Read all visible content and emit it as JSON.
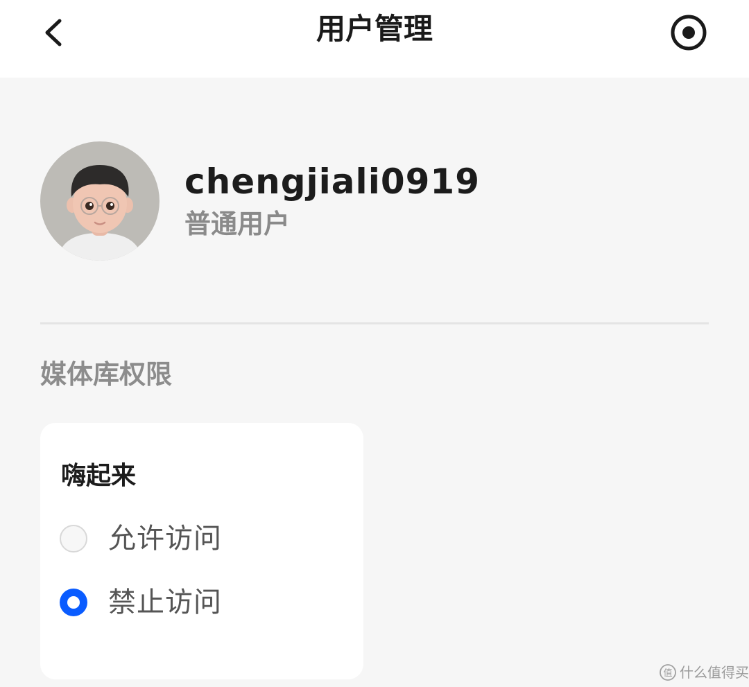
{
  "header": {
    "title": "用户管理",
    "back_icon": "chevron-left-icon",
    "action_icon": "target-icon"
  },
  "profile": {
    "username": "chengjiali0919",
    "role": "普通用户",
    "avatar": "cartoon-avatar"
  },
  "permissions": {
    "section_title": "媒体库权限",
    "libraries": [
      {
        "name": "嗨起来",
        "options": [
          {
            "label": "允许访问",
            "selected": false
          },
          {
            "label": "禁止访问",
            "selected": true
          }
        ]
      }
    ]
  },
  "watermark": {
    "text": "什么值得买",
    "icon": "zhi-logo-icon"
  },
  "colors": {
    "accent": "#0a5cff",
    "background": "#f6f6f6",
    "card": "#ffffff"
  }
}
